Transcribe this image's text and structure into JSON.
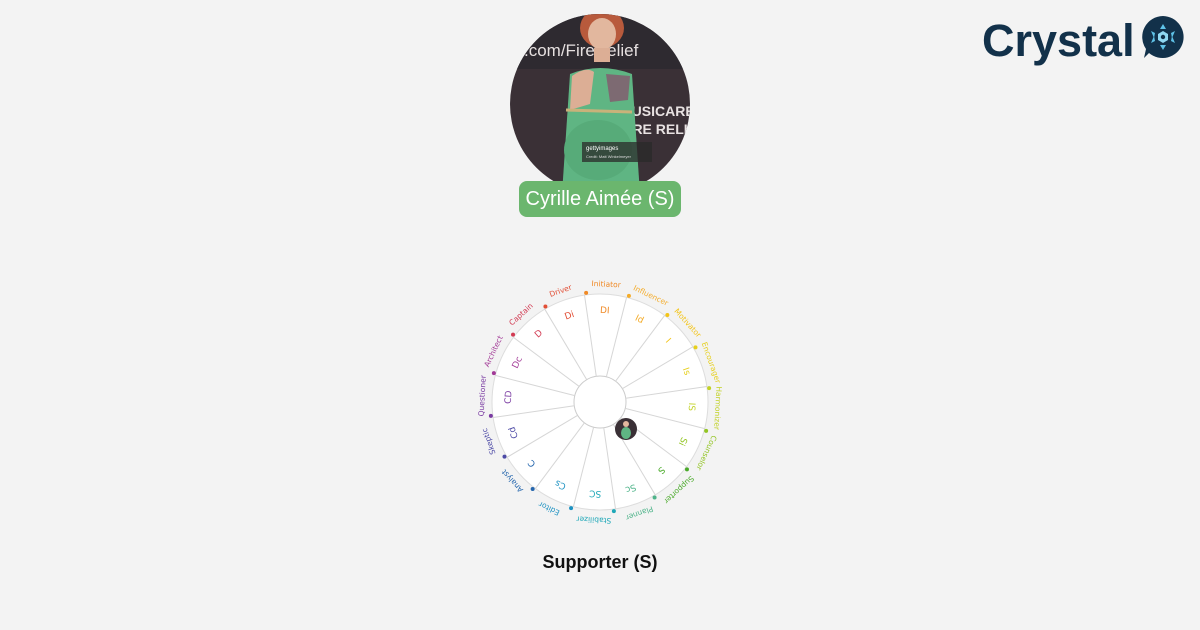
{
  "brand": {
    "name": "Crystal",
    "text_color": "#12314a",
    "mark_color": "#12314a"
  },
  "profile": {
    "name_label": "Cyrille Aimée (S)",
    "pill_color": "#6bb66e",
    "photo_backdrop_text": [
      ".com/FireRelief",
      "MUSICARE",
      "FIRE RELI"
    ],
    "photo_watermark": [
      "gettyimages",
      "Credit: Matt Winkelmeyer"
    ]
  },
  "wheel": {
    "caption": "Supporter (S)",
    "sections": [
      {
        "inner": "DI",
        "outer": "Initiator",
        "color": "#f08a26"
      },
      {
        "inner": "Id",
        "outer": "Influencer",
        "color": "#f4ac2a"
      },
      {
        "inner": "I",
        "outer": "Motivator",
        "color": "#f3c418"
      },
      {
        "inner": "Is",
        "outer": "Encourager",
        "color": "#e6cf1b"
      },
      {
        "inner": "IS",
        "outer": "Harmonizer",
        "color": "#c2d227"
      },
      {
        "inner": "Si",
        "outer": "Counselor",
        "color": "#93c524"
      },
      {
        "inner": "S",
        "outer": "Supporter",
        "color": "#4aaa2a"
      },
      {
        "inner": "Sc",
        "outer": "Planner",
        "color": "#4fb48a"
      },
      {
        "inner": "SC",
        "outer": "Stabilizer",
        "color": "#1fa8b8"
      },
      {
        "inner": "Cs",
        "outer": "Editor",
        "color": "#1e92c2"
      },
      {
        "inner": "C",
        "outer": "Analyst",
        "color": "#2566ad"
      },
      {
        "inner": "Cd",
        "outer": "Skeptic",
        "color": "#4d4aa6"
      },
      {
        "inner": "CD",
        "outer": "Questioner",
        "color": "#7a3ba2"
      },
      {
        "inner": "Dc",
        "outer": "Architect",
        "color": "#a23a97"
      },
      {
        "inner": "D",
        "outer": "Captain",
        "color": "#d23a52"
      },
      {
        "inner": "Di",
        "outer": "Driver",
        "color": "#e24f36"
      }
    ],
    "marker": {
      "type": "Supporter"
    }
  }
}
